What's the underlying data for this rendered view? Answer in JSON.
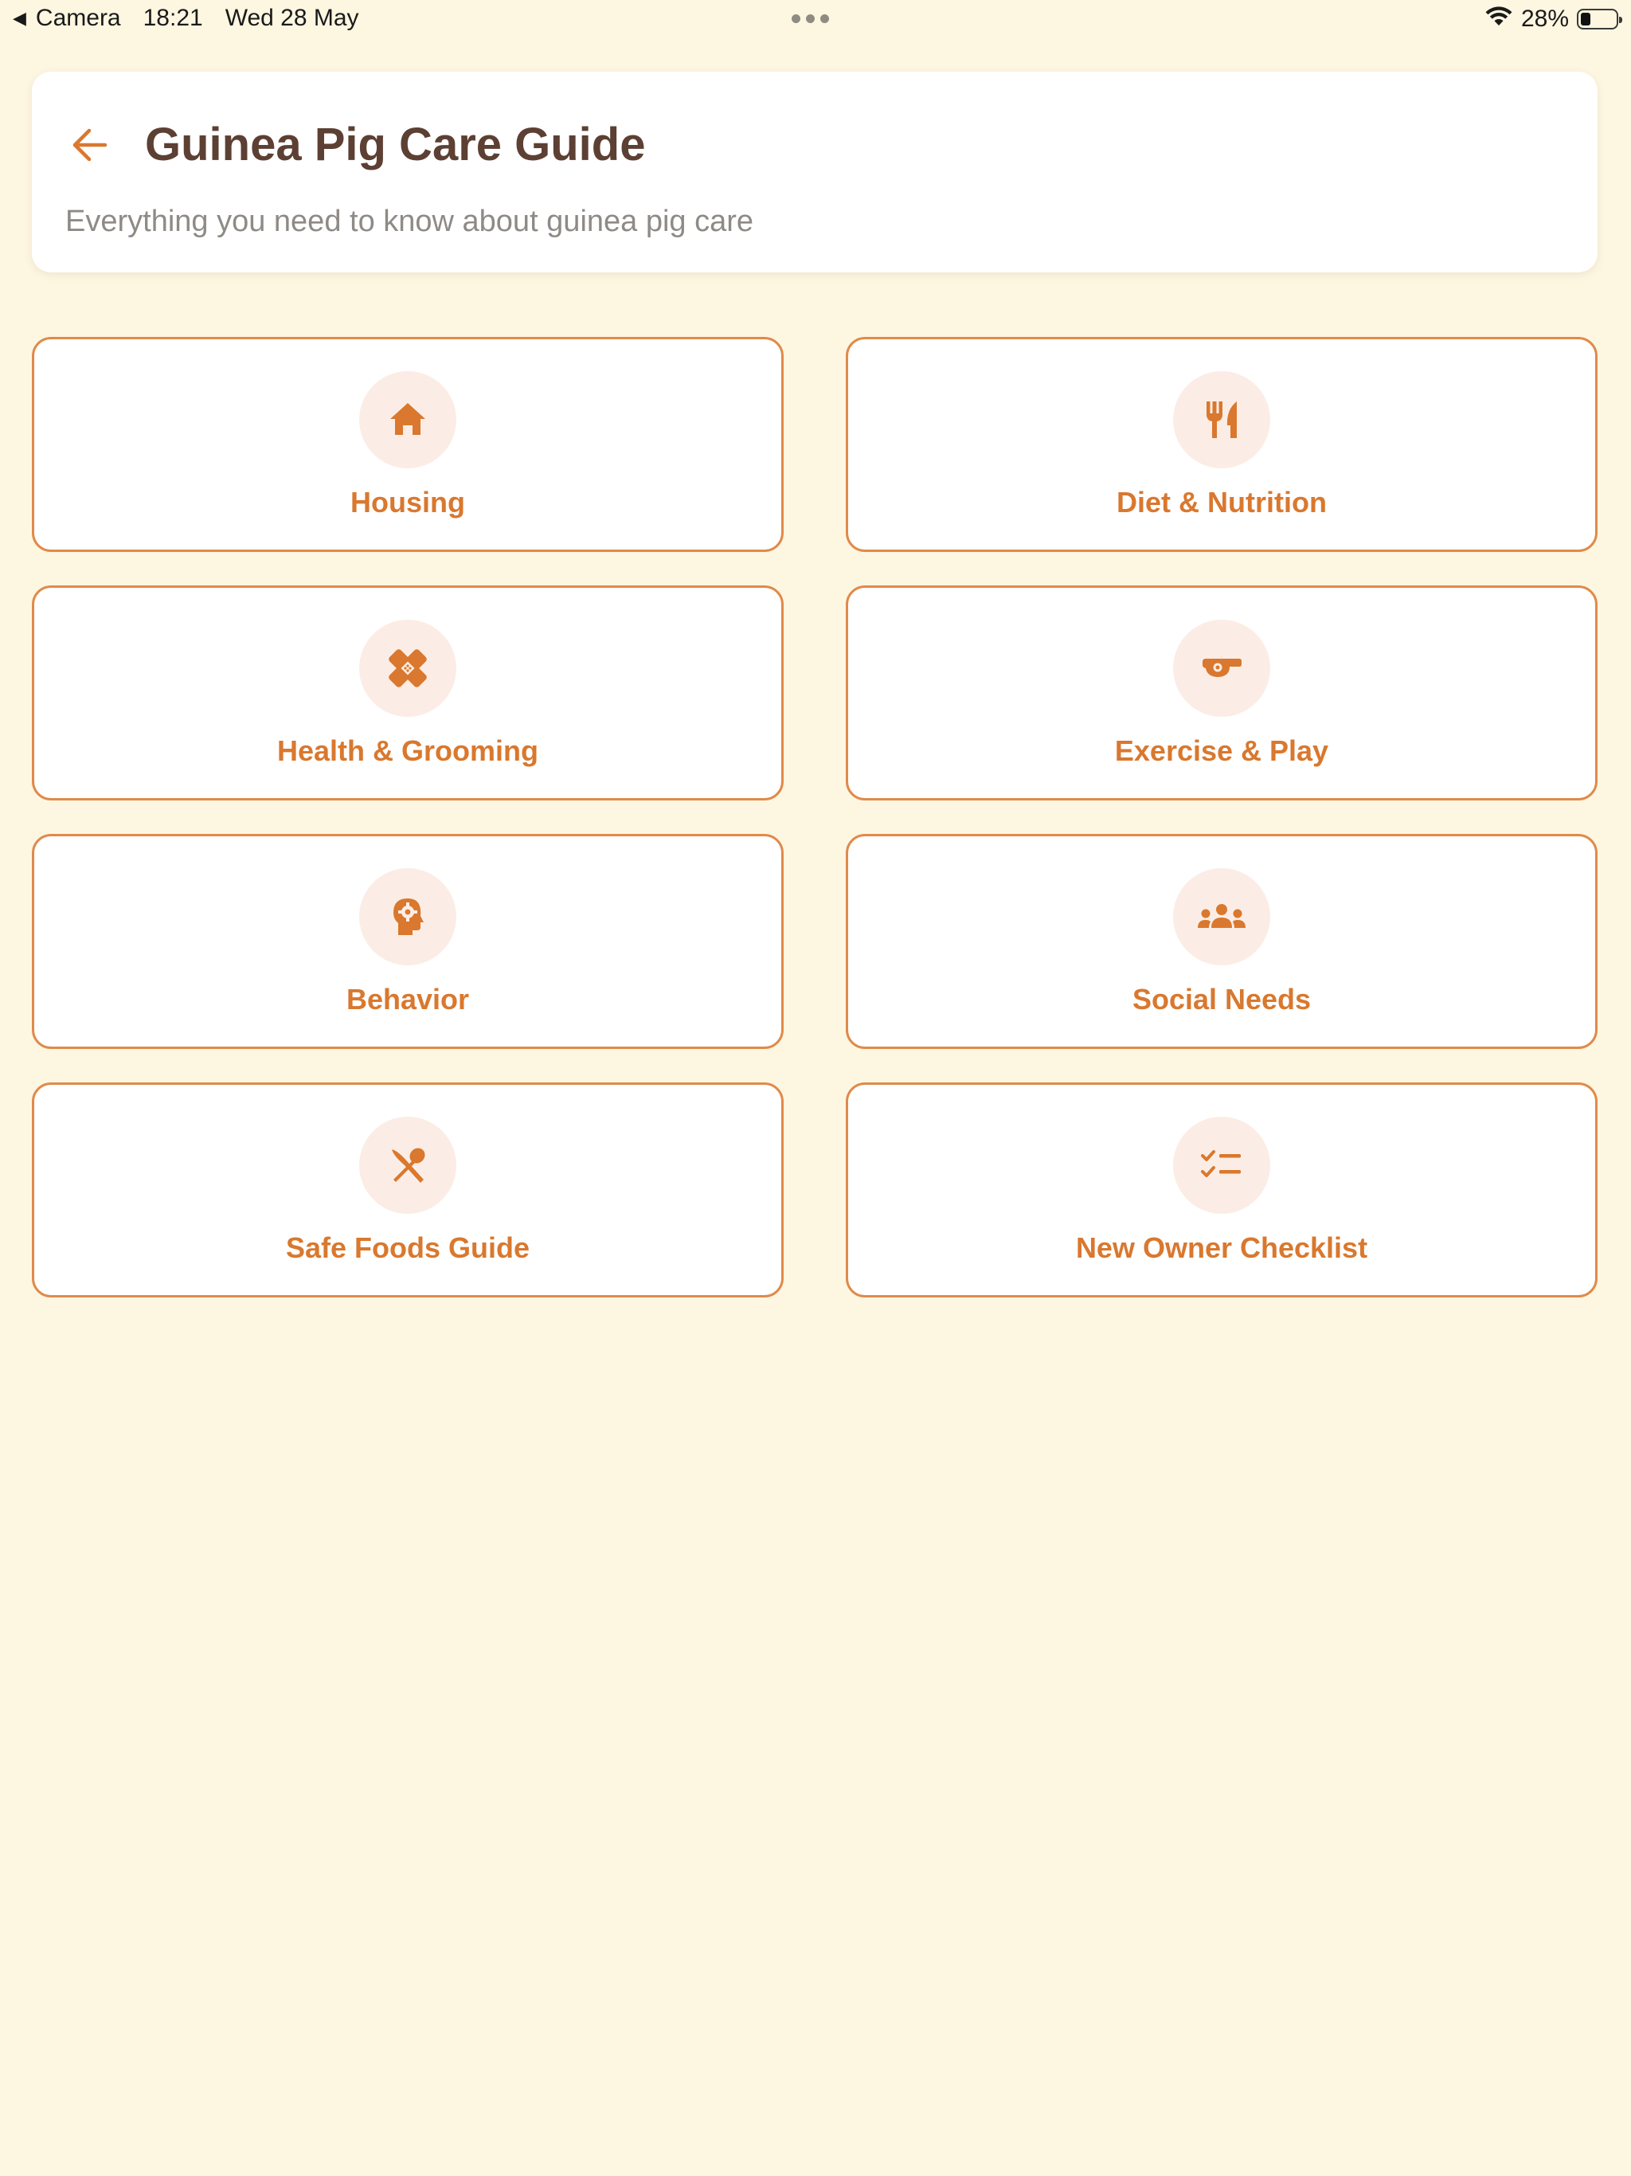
{
  "status_bar": {
    "back_app": "Camera",
    "time": "18:21",
    "date": "Wed 28 May",
    "battery": "28%",
    "battery_level": 0.28
  },
  "header": {
    "title": "Guinea Pig Care Guide",
    "subtitle": "Everything you need to know about guinea pig care"
  },
  "colors": {
    "background": "#FDF6E1",
    "accent": "#D9782E",
    "card_border": "#E08A4A",
    "icon_circle": "#FBEDE5",
    "title": "#5C4033",
    "subtitle": "#8E8A86"
  },
  "categories": [
    {
      "label": "Housing",
      "icon": "house-icon"
    },
    {
      "label": "Diet & Nutrition",
      "icon": "fork-knife-icon"
    },
    {
      "label": "Health & Grooming",
      "icon": "bandage-icon"
    },
    {
      "label": "Exercise & Play",
      "icon": "whistle-icon"
    },
    {
      "label": "Behavior",
      "icon": "head-gear-icon"
    },
    {
      "label": "Social Needs",
      "icon": "group-icon"
    },
    {
      "label": "Safe Foods Guide",
      "icon": "spoon-knife-cross-icon"
    },
    {
      "label": "New Owner Checklist",
      "icon": "checklist-icon"
    }
  ]
}
